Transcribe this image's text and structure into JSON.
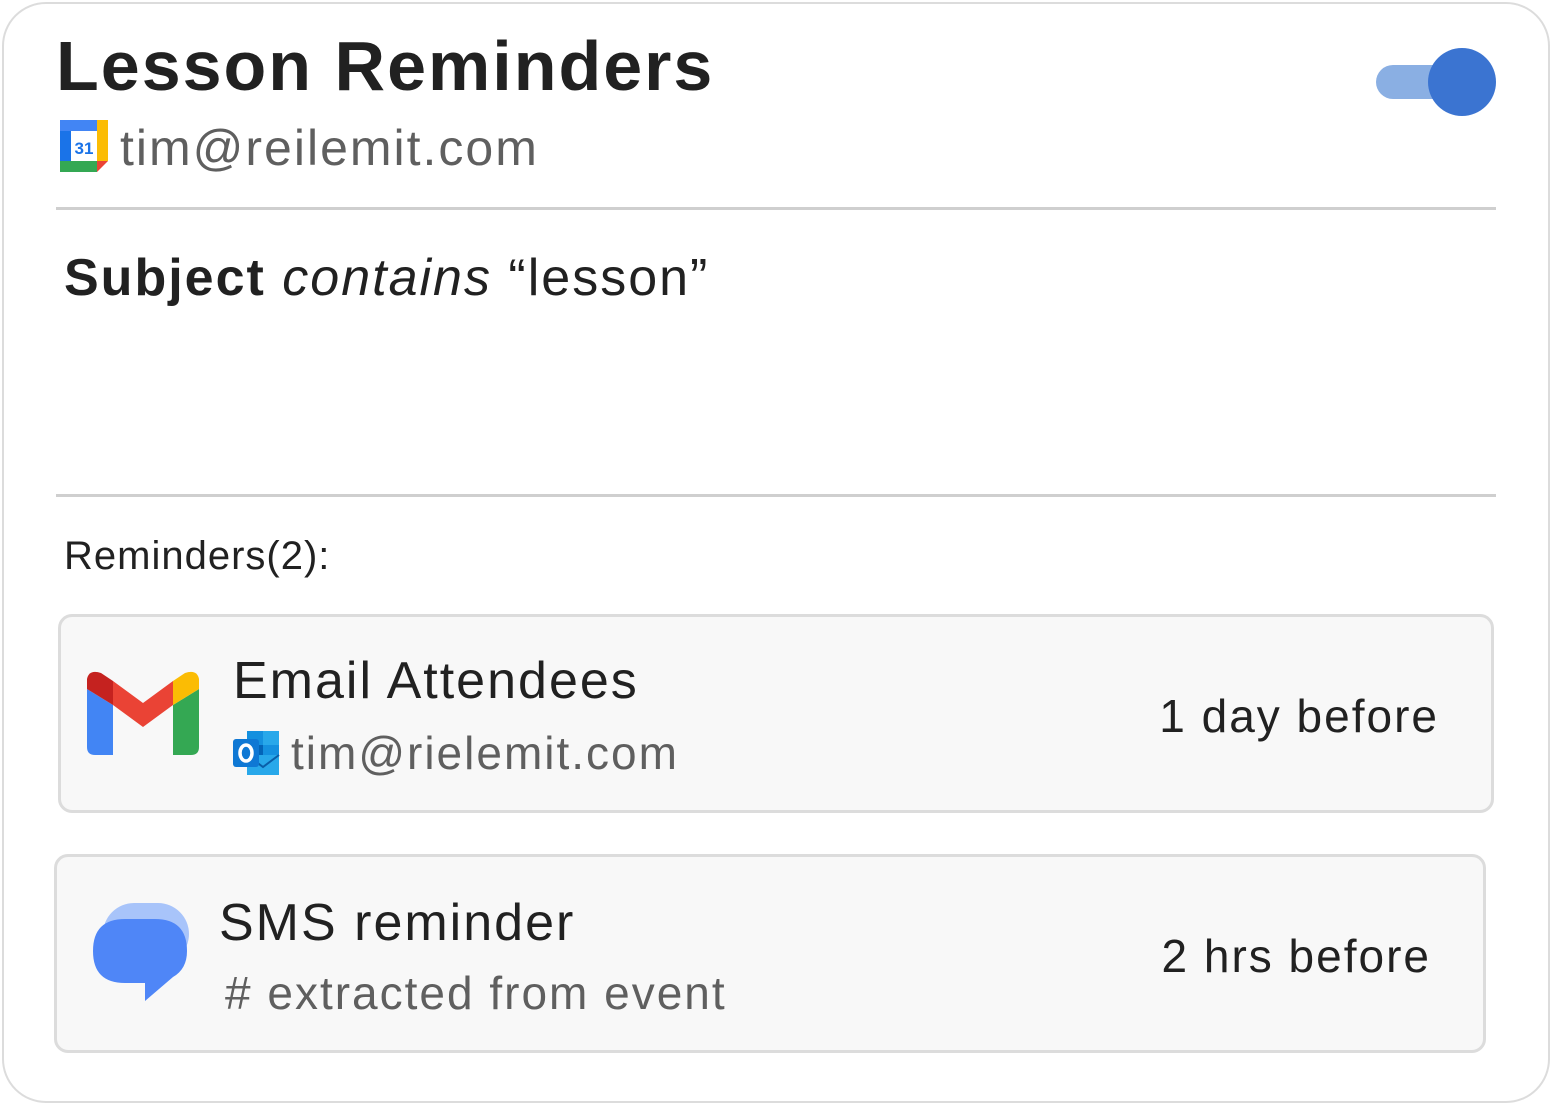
{
  "card": {
    "title": "Lesson Reminders",
    "calendar_icon": "google-calendar-icon",
    "calendar_icon_text": "31",
    "account": "tim@reilemit.com",
    "enabled": true,
    "accent_color": "#3b74d1"
  },
  "rule": {
    "field": "Subject",
    "operator": "contains",
    "value": "“lesson”"
  },
  "reminders": {
    "label": "Reminders(2):",
    "items": [
      {
        "icon": "gmail-icon",
        "title": "Email Attendees",
        "sub_icon": "outlook-icon",
        "subtitle": "tim@rielemit.com",
        "timing": "1 day before"
      },
      {
        "icon": "messages-icon",
        "title": "SMS reminder",
        "subtitle": "# extracted from event",
        "timing": "2 hrs before"
      }
    ]
  }
}
